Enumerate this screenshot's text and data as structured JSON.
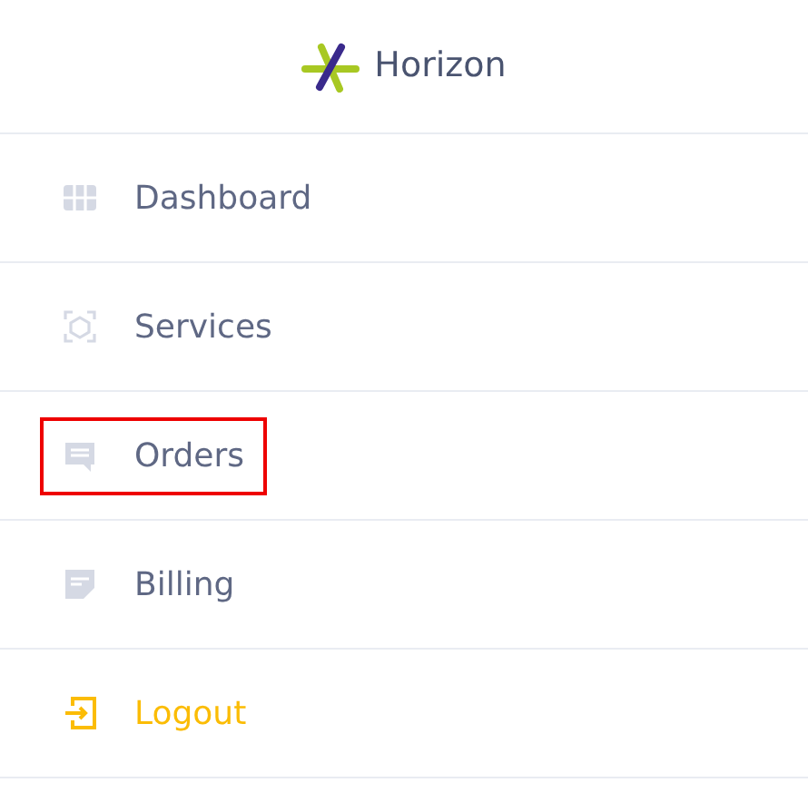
{
  "brand": {
    "name": "Horizon"
  },
  "menu": [
    {
      "label": "Dashboard",
      "kind": "link",
      "highlighted": false
    },
    {
      "label": "Services",
      "kind": "link",
      "highlighted": false
    },
    {
      "label": "Orders",
      "kind": "link",
      "highlighted": true
    },
    {
      "label": "Billing",
      "kind": "link",
      "highlighted": false
    },
    {
      "label": "Logout",
      "kind": "logout",
      "highlighted": false
    }
  ]
}
